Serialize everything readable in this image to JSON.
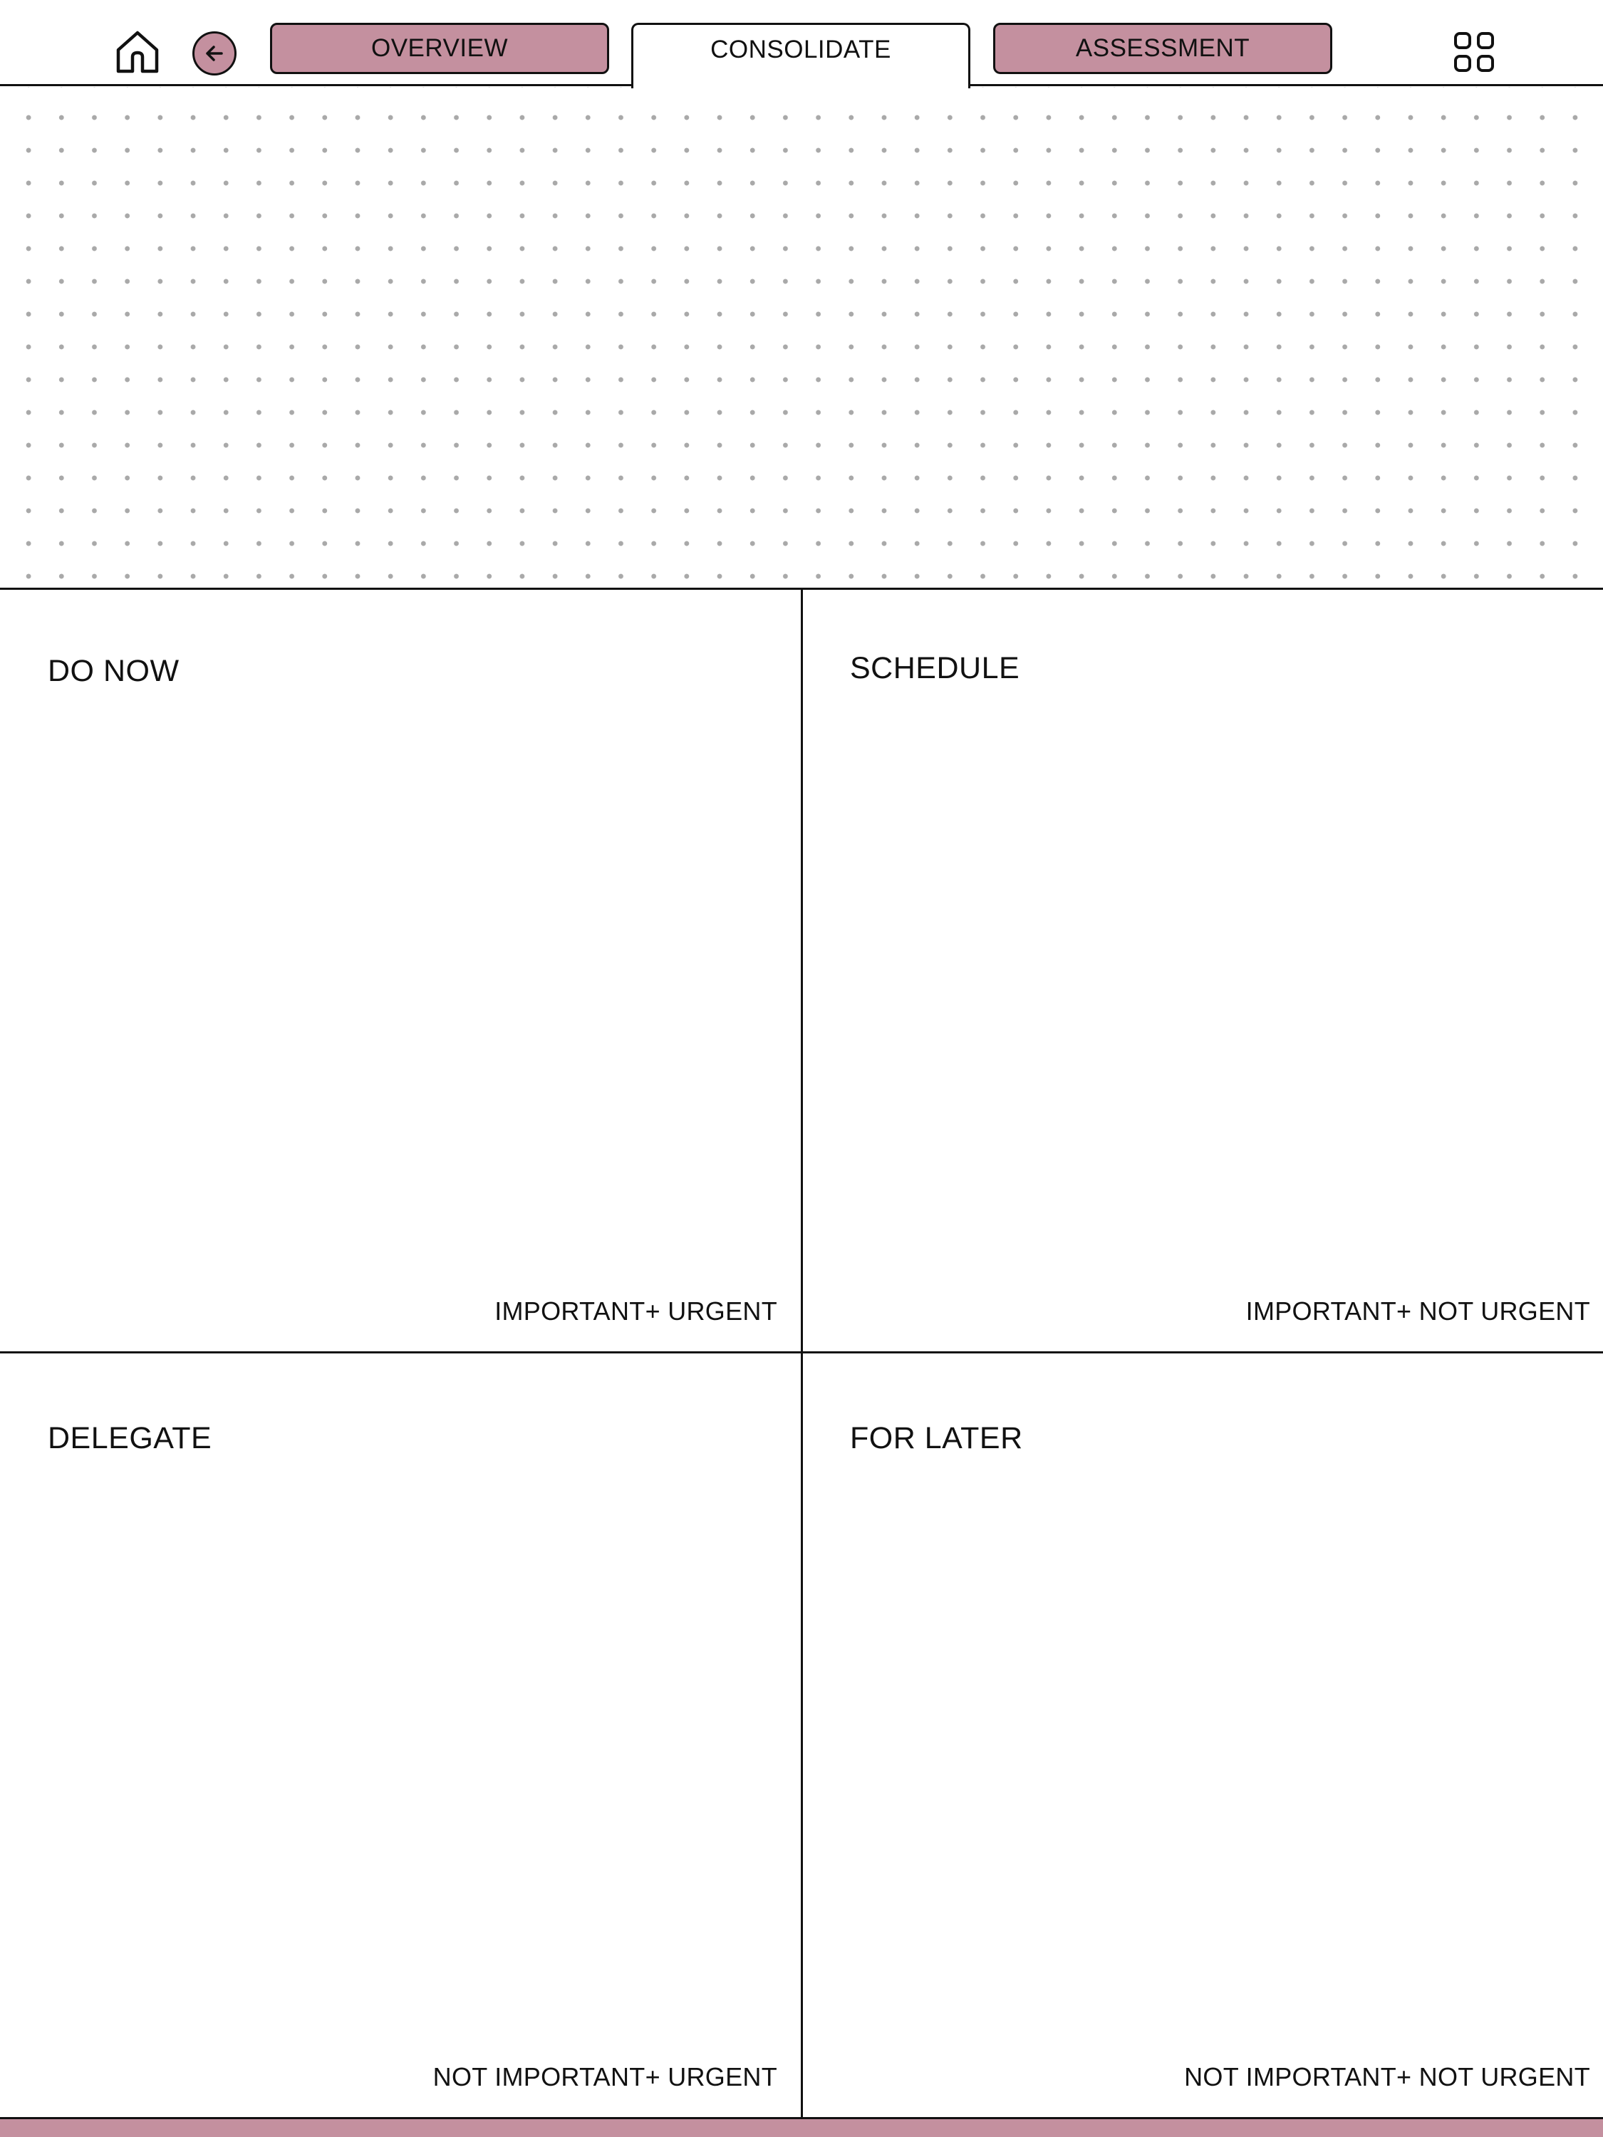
{
  "theme": {
    "accent": "#c4909f",
    "line": "#111111",
    "dot": "#a9a9a9",
    "background": "#ffffff"
  },
  "header": {
    "home_icon": "home-icon",
    "back_icon": "arrow-left-circle-icon",
    "grid_icon": "grid-icon",
    "tabs": [
      {
        "label": "OVERVIEW",
        "active": false
      },
      {
        "label": "CONSOLIDATE",
        "active": true
      },
      {
        "label": "ASSESSMENT",
        "active": false
      }
    ]
  },
  "matrix": {
    "quadrants": [
      {
        "title": "DO NOW",
        "caption": "IMPORTANT+ URGENT"
      },
      {
        "title": "SCHEDULE",
        "caption": "IMPORTANT+ NOT URGENT"
      },
      {
        "title": "DELEGATE",
        "caption": "NOT IMPORTANT+ URGENT"
      },
      {
        "title": "FOR LATER",
        "caption": "NOT IMPORTANT+ NOT URGENT"
      }
    ]
  }
}
